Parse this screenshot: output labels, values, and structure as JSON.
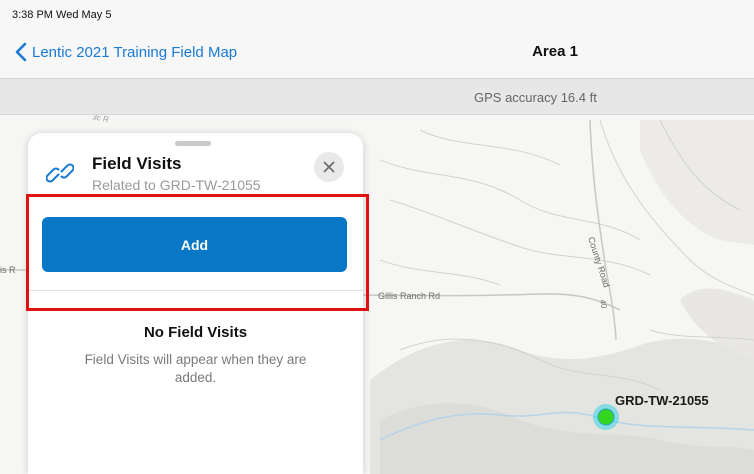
{
  "status_bar": {
    "time": "3:38 PM  Wed May 5"
  },
  "nav": {
    "back_label": "Lentic 2021 Training Field Map",
    "title": "Area 1"
  },
  "gps": {
    "accuracy_text": "GPS accuracy 16.4 ft"
  },
  "map": {
    "road_gillis": "Gillis Ranch Rd",
    "road_county": "County Road",
    "road_number": "40",
    "label_left_edge": "is R",
    "label_top_edge": "3c R",
    "feature_label": "GRD-TW-21055",
    "marker_color": "#35d620"
  },
  "panel": {
    "title": "Field Visits",
    "subtitle": "Related to GRD-TW-21055",
    "add_label": "Add",
    "empty_title": "No Field Visits",
    "empty_description": "Field Visits will appear when they are added."
  },
  "colors": {
    "accent": "#1a7ad4",
    "button": "#0878c6",
    "highlight": "#e01111"
  }
}
